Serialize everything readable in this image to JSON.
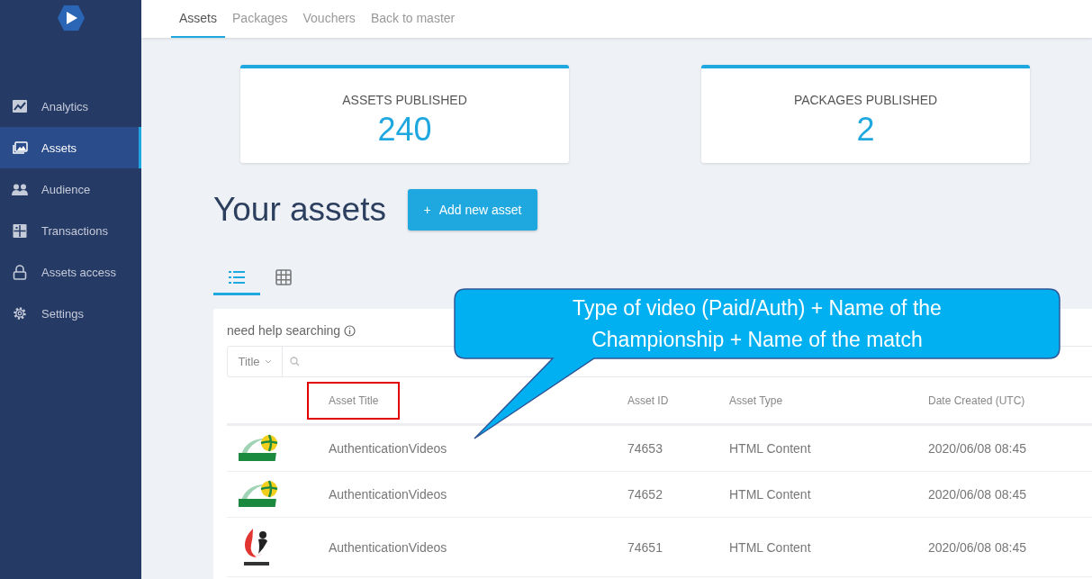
{
  "sidebar": {
    "items": [
      {
        "label": "Analytics",
        "selected": false
      },
      {
        "label": "Assets",
        "selected": true
      },
      {
        "label": "Audience",
        "selected": false
      },
      {
        "label": "Transactions",
        "selected": false
      },
      {
        "label": "Assets access",
        "selected": false
      },
      {
        "label": "Settings",
        "selected": false
      }
    ]
  },
  "top_tabs": [
    {
      "label": "Assets",
      "selected": true
    },
    {
      "label": "Packages",
      "selected": false
    },
    {
      "label": "Vouchers",
      "selected": false
    },
    {
      "label": "Back to master",
      "selected": false
    }
  ],
  "stats": [
    {
      "label": "ASSETS PUBLISHED",
      "value": "240"
    },
    {
      "label": "PACKAGES PUBLISHED",
      "value": "2"
    }
  ],
  "heading": "Your assets",
  "add_button": {
    "icon": "+",
    "label": "Add new asset"
  },
  "view_tabs": [
    {
      "kind": "list",
      "selected": true
    },
    {
      "kind": "grid",
      "selected": false
    }
  ],
  "search": {
    "help": "need help searching",
    "filter": "Title"
  },
  "table": {
    "columns": [
      {
        "label": "Asset Title",
        "highlighted": true
      },
      {
        "label": "Asset ID",
        "highlighted": false
      },
      {
        "label": "Asset Type",
        "highlighted": false
      },
      {
        "label": "Date Created (UTC)",
        "highlighted": false
      }
    ],
    "rows": [
      {
        "kind": "khimik",
        "title": "AuthenticationVideos",
        "id": "74653",
        "type": "HTML Content",
        "date": "2020/06/08 08:45"
      },
      {
        "kind": "khimik",
        "title": "AuthenticationVideos",
        "id": "74652",
        "type": "HTML Content",
        "date": "2020/06/08 08:45"
      },
      {
        "kind": "prometey",
        "title": "AuthenticationVideos",
        "id": "74651",
        "type": "HTML Content",
        "date": "2020/06/08 08:45"
      }
    ]
  },
  "callout": {
    "lines": [
      "Type of video (Paid/Auth) + Name of the",
      "Championship + Name of the match"
    ]
  }
}
